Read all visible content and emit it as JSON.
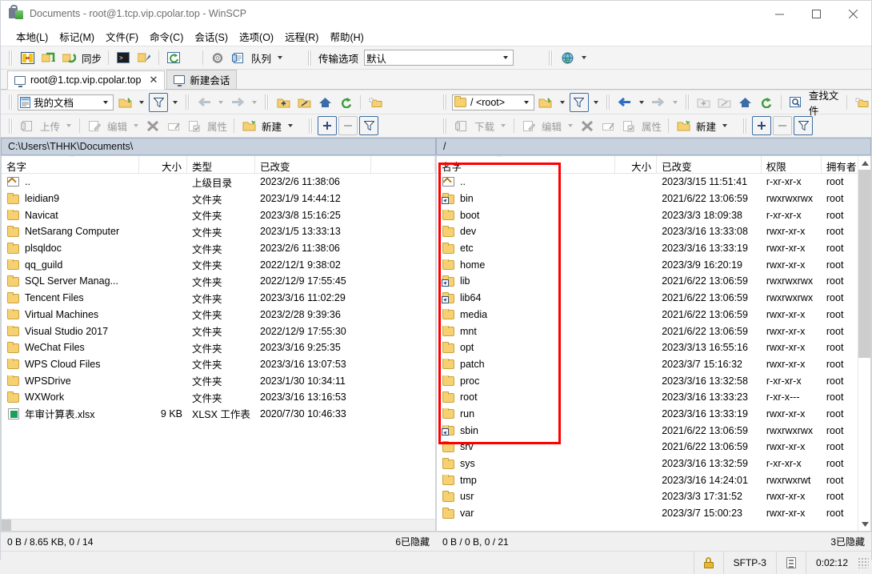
{
  "window": {
    "title": "Documents - root@1.tcp.vip.cpolar.top - WinSCP",
    "minimize_label": "—",
    "maximize_label": "□",
    "close_label": "✕"
  },
  "menu": [
    {
      "label": "本地(L)"
    },
    {
      "label": "标记(M)"
    },
    {
      "label": "文件(F)"
    },
    {
      "label": "命令(C)"
    },
    {
      "label": "会话(S)"
    },
    {
      "label": "选项(O)"
    },
    {
      "label": "远程(R)"
    },
    {
      "label": "帮助(H)"
    }
  ],
  "main_toolbar": {
    "sync_label": "同步",
    "queue_label": "队列",
    "transfer_options_label": "传输选项",
    "transfer_preset_value": "默认"
  },
  "tabs": [
    {
      "label": "root@1.tcp.vip.cpolar.top",
      "close": "✕",
      "active": true
    },
    {
      "label": "新建会话",
      "active": false
    }
  ],
  "local_toolbar": {
    "location_value": "我的文档",
    "upload_label": "上传",
    "edit_label": "编辑",
    "properties_label": "属性",
    "new_label": "新建"
  },
  "remote_toolbar": {
    "location_value": "/ <root>",
    "download_label": "下载",
    "edit_label": "编辑",
    "properties_label": "属性",
    "new_label": "新建",
    "find_files_label": "查找文件"
  },
  "local_pane": {
    "path": "C:\\Users\\THHK\\Documents\\",
    "columns": [
      "名字",
      "大小",
      "类型",
      "已改变"
    ],
    "sort_indicator": "^",
    "rows": [
      {
        "icon": "up-dir-icon",
        "name": "..",
        "size": "",
        "type": "上级目录",
        "changed": "2023/2/6  11:38:06"
      },
      {
        "icon": "folder-icon",
        "name": "leidian9",
        "size": "",
        "type": "文件夹",
        "changed": "2023/1/9  14:44:12"
      },
      {
        "icon": "folder-icon",
        "name": "Navicat",
        "size": "",
        "type": "文件夹",
        "changed": "2023/3/8  15:16:25"
      },
      {
        "icon": "folder-icon",
        "name": "NetSarang Computer",
        "size": "",
        "type": "文件夹",
        "changed": "2023/1/5  13:33:13"
      },
      {
        "icon": "folder-icon",
        "name": "plsqldoc",
        "size": "",
        "type": "文件夹",
        "changed": "2023/2/6  11:38:06"
      },
      {
        "icon": "folder-icon",
        "name": "qq_guild",
        "size": "",
        "type": "文件夹",
        "changed": "2022/12/1  9:38:02"
      },
      {
        "icon": "folder-icon",
        "name": "SQL Server Manag...",
        "size": "",
        "type": "文件夹",
        "changed": "2022/12/9  17:55:45"
      },
      {
        "icon": "folder-icon",
        "name": "Tencent Files",
        "size": "",
        "type": "文件夹",
        "changed": "2023/3/16  11:02:29"
      },
      {
        "icon": "folder-icon",
        "name": "Virtual Machines",
        "size": "",
        "type": "文件夹",
        "changed": "2023/2/28  9:39:36"
      },
      {
        "icon": "folder-icon",
        "name": "Visual Studio 2017",
        "size": "",
        "type": "文件夹",
        "changed": "2022/12/9  17:55:30"
      },
      {
        "icon": "folder-icon",
        "name": "WeChat Files",
        "size": "",
        "type": "文件夹",
        "changed": "2023/3/16  9:25:35"
      },
      {
        "icon": "folder-icon",
        "name": "WPS Cloud Files",
        "size": "",
        "type": "文件夹",
        "changed": "2023/3/16  13:07:53"
      },
      {
        "icon": "folder-icon",
        "name": "WPSDrive",
        "size": "",
        "type": "文件夹",
        "changed": "2023/1/30  10:34:11"
      },
      {
        "icon": "folder-icon",
        "name": "WXWork",
        "size": "",
        "type": "文件夹",
        "changed": "2023/3/16  13:16:53"
      },
      {
        "icon": "xlsx-icon",
        "name": "年审计算表.xlsx",
        "size": "9 KB",
        "type": "XLSX 工作表",
        "changed": "2020/7/30  10:46:33"
      }
    ],
    "status_left": "0 B / 8.65 KB,  0 / 14",
    "status_right": "6已隐藏"
  },
  "remote_pane": {
    "path": "/",
    "columns": [
      "名字",
      "大小",
      "已改变",
      "权限",
      "拥有者"
    ],
    "sort_indicator": "^",
    "rows": [
      {
        "icon": "up-dir-icon",
        "name": "..",
        "size": "",
        "changed": "2023/3/15 11:51:41",
        "rights": "r-xr-xr-x",
        "owner": "root"
      },
      {
        "icon": "folder-link-icon",
        "name": "bin",
        "size": "",
        "changed": "2021/6/22 13:06:59",
        "rights": "rwxrwxrwx",
        "owner": "root"
      },
      {
        "icon": "folder-icon",
        "name": "boot",
        "size": "",
        "changed": "2023/3/3 18:09:38",
        "rights": "r-xr-xr-x",
        "owner": "root"
      },
      {
        "icon": "folder-icon",
        "name": "dev",
        "size": "",
        "changed": "2023/3/16 13:33:08",
        "rights": "rwxr-xr-x",
        "owner": "root"
      },
      {
        "icon": "folder-icon",
        "name": "etc",
        "size": "",
        "changed": "2023/3/16 13:33:19",
        "rights": "rwxr-xr-x",
        "owner": "root"
      },
      {
        "icon": "folder-icon",
        "name": "home",
        "size": "",
        "changed": "2023/3/9 16:20:19",
        "rights": "rwxr-xr-x",
        "owner": "root"
      },
      {
        "icon": "folder-link-icon",
        "name": "lib",
        "size": "",
        "changed": "2021/6/22 13:06:59",
        "rights": "rwxrwxrwx",
        "owner": "root"
      },
      {
        "icon": "folder-link-icon",
        "name": "lib64",
        "size": "",
        "changed": "2021/6/22 13:06:59",
        "rights": "rwxrwxrwx",
        "owner": "root"
      },
      {
        "icon": "folder-icon",
        "name": "media",
        "size": "",
        "changed": "2021/6/22 13:06:59",
        "rights": "rwxr-xr-x",
        "owner": "root"
      },
      {
        "icon": "folder-icon",
        "name": "mnt",
        "size": "",
        "changed": "2021/6/22 13:06:59",
        "rights": "rwxr-xr-x",
        "owner": "root"
      },
      {
        "icon": "folder-icon",
        "name": "opt",
        "size": "",
        "changed": "2023/3/13 16:55:16",
        "rights": "rwxr-xr-x",
        "owner": "root"
      },
      {
        "icon": "folder-icon",
        "name": "patch",
        "size": "",
        "changed": "2023/3/7 15:16:32",
        "rights": "rwxr-xr-x",
        "owner": "root"
      },
      {
        "icon": "folder-icon",
        "name": "proc",
        "size": "",
        "changed": "2023/3/16 13:32:58",
        "rights": "r-xr-xr-x",
        "owner": "root"
      },
      {
        "icon": "folder-icon",
        "name": "root",
        "size": "",
        "changed": "2023/3/16 13:33:23",
        "rights": "r-xr-x---",
        "owner": "root"
      },
      {
        "icon": "folder-icon",
        "name": "run",
        "size": "",
        "changed": "2023/3/16 13:33:19",
        "rights": "rwxr-xr-x",
        "owner": "root"
      },
      {
        "icon": "folder-link-icon",
        "name": "sbin",
        "size": "",
        "changed": "2021/6/22 13:06:59",
        "rights": "rwxrwxrwx",
        "owner": "root"
      },
      {
        "icon": "folder-icon",
        "name": "srv",
        "size": "",
        "changed": "2021/6/22 13:06:59",
        "rights": "rwxr-xr-x",
        "owner": "root"
      },
      {
        "icon": "folder-icon",
        "name": "sys",
        "size": "",
        "changed": "2023/3/16 13:32:59",
        "rights": "r-xr-xr-x",
        "owner": "root"
      },
      {
        "icon": "folder-icon",
        "name": "tmp",
        "size": "",
        "changed": "2023/3/16 14:24:01",
        "rights": "rwxrwxrwt",
        "owner": "root"
      },
      {
        "icon": "folder-icon",
        "name": "usr",
        "size": "",
        "changed": "2023/3/3 17:31:52",
        "rights": "rwxr-xr-x",
        "owner": "root"
      },
      {
        "icon": "folder-icon",
        "name": "var",
        "size": "",
        "changed": "2023/3/7 15:00:23",
        "rights": "rwxr-xr-x",
        "owner": "root"
      }
    ],
    "status_left": "0 B / 0 B,  0 / 21",
    "status_right": "3已隐藏"
  },
  "bottom_bar": {
    "protocol": "SFTP-3",
    "elapsed": "0:02:12"
  },
  "annotation": {
    "color": "#ff0000",
    "shape": "rectangle"
  }
}
